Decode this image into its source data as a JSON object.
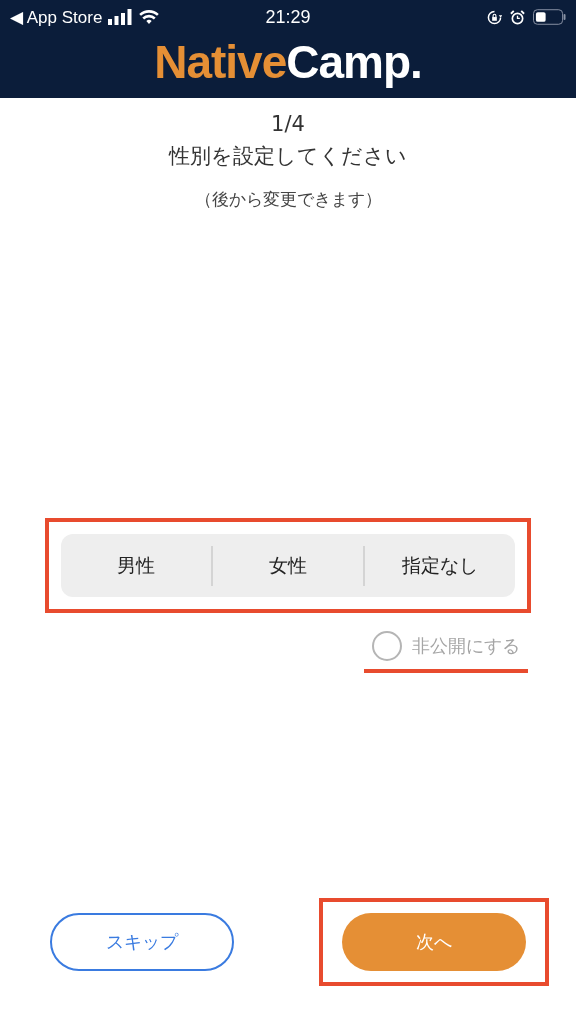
{
  "status_bar": {
    "back_label": "◀ App Store",
    "time": "21:29"
  },
  "logo": {
    "accent": "Native",
    "rest": "Camp."
  },
  "step": "1/4",
  "title": "性別を設定してください",
  "subtitle": "（後から変更できます）",
  "options": [
    {
      "label": "男性",
      "selected": false
    },
    {
      "label": "女性",
      "selected": false
    },
    {
      "label": "指定なし",
      "selected": false
    }
  ],
  "private_option": {
    "label": "非公開にする",
    "checked": false
  },
  "buttons": {
    "skip": "スキップ",
    "next": "次へ"
  }
}
